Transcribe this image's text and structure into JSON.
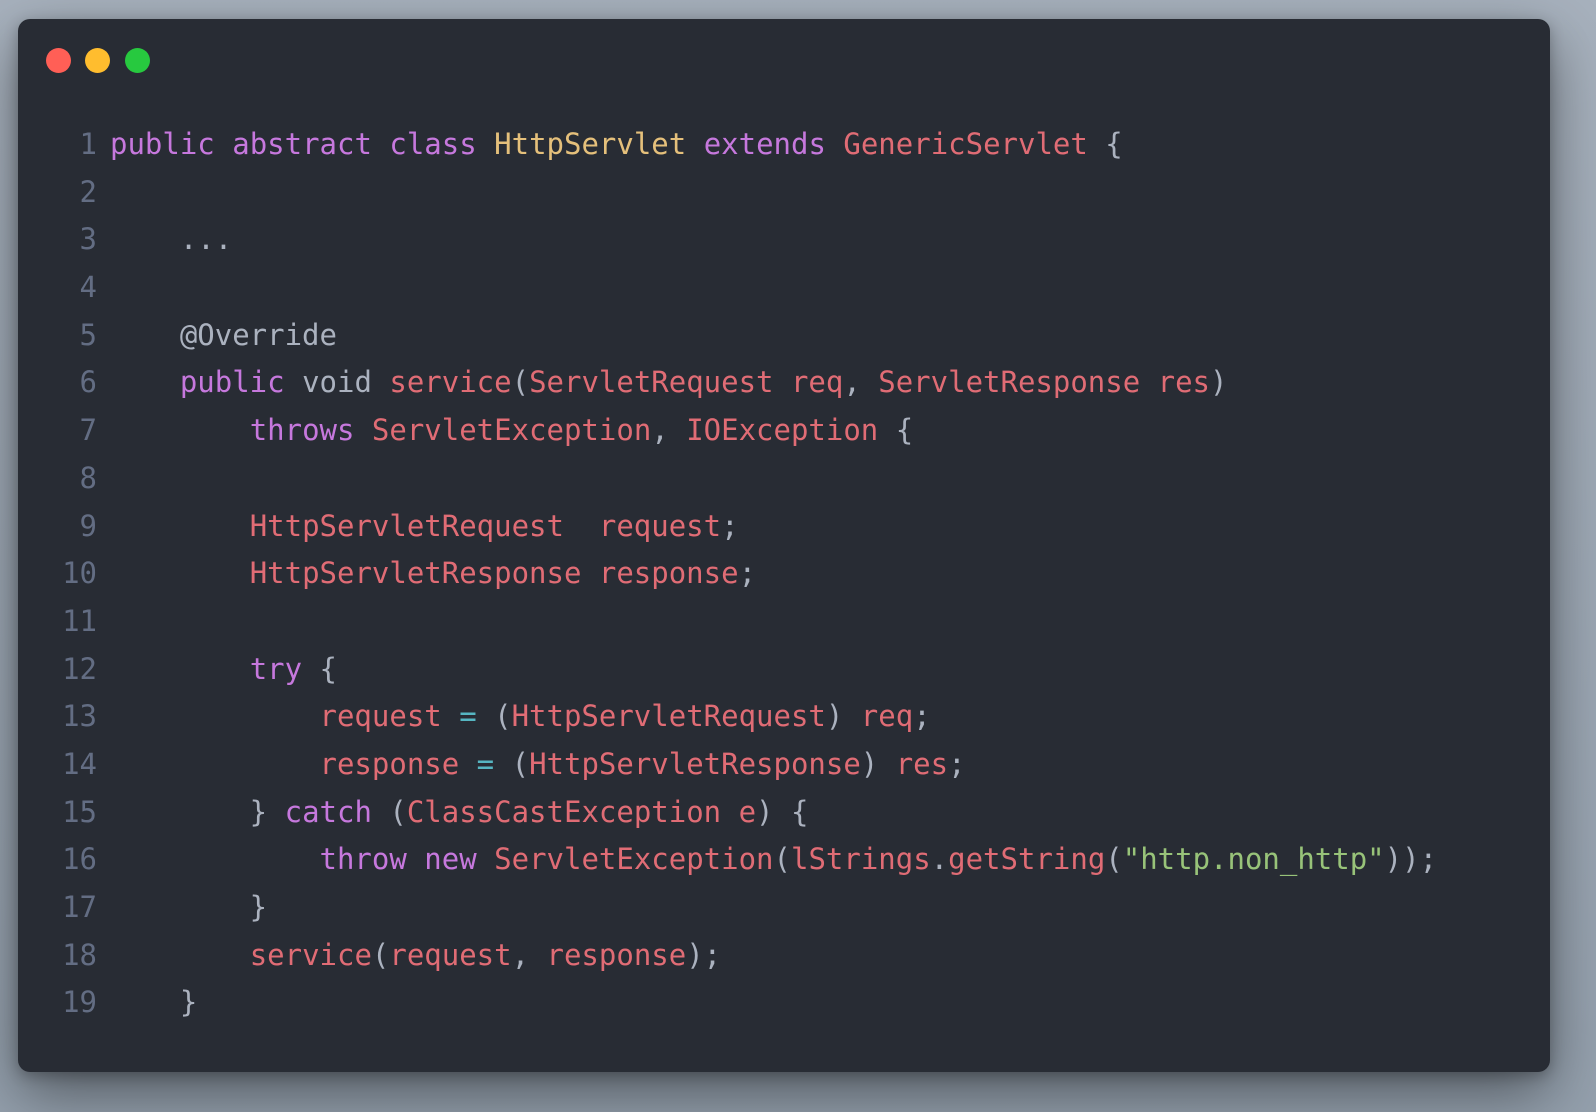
{
  "window": {
    "controls": {
      "close": {
        "icon": "close-dot-icon",
        "color": "#ff5f56"
      },
      "minimize": {
        "icon": "minimize-dot-icon",
        "color": "#ffbd2e"
      },
      "maximize": {
        "icon": "maximize-dot-icon",
        "color": "#27c93f"
      }
    }
  },
  "theme": {
    "background": "#282c34",
    "line_number": "#636d83",
    "plain": "#abb2bf",
    "keyword": "#c678dd",
    "class_name": "#e5c07b",
    "identifier": "#e06c75",
    "operator": "#56b6c2",
    "string": "#98c379"
  },
  "code": {
    "lines": [
      {
        "number": "1",
        "tokens": [
          {
            "t": "public",
            "c": "keyword"
          },
          {
            "t": " ",
            "c": "plain"
          },
          {
            "t": "abstract",
            "c": "keyword"
          },
          {
            "t": " ",
            "c": "plain"
          },
          {
            "t": "class",
            "c": "keyword"
          },
          {
            "t": " ",
            "c": "plain"
          },
          {
            "t": "HttpServlet",
            "c": "class_name"
          },
          {
            "t": " ",
            "c": "plain"
          },
          {
            "t": "extends",
            "c": "keyword"
          },
          {
            "t": " ",
            "c": "plain"
          },
          {
            "t": "GenericServlet",
            "c": "identifier"
          },
          {
            "t": " {",
            "c": "plain"
          }
        ]
      },
      {
        "number": "2",
        "tokens": []
      },
      {
        "number": "3",
        "tokens": [
          {
            "t": "    ...",
            "c": "plain"
          }
        ]
      },
      {
        "number": "4",
        "tokens": []
      },
      {
        "number": "5",
        "tokens": [
          {
            "t": "    @Override",
            "c": "plain"
          }
        ]
      },
      {
        "number": "6",
        "tokens": [
          {
            "t": "    ",
            "c": "plain"
          },
          {
            "t": "public",
            "c": "keyword"
          },
          {
            "t": " void ",
            "c": "plain"
          },
          {
            "t": "service",
            "c": "identifier"
          },
          {
            "t": "(",
            "c": "plain"
          },
          {
            "t": "ServletRequest req",
            "c": "identifier"
          },
          {
            "t": ", ",
            "c": "plain"
          },
          {
            "t": "ServletResponse res",
            "c": "identifier"
          },
          {
            "t": ")",
            "c": "plain"
          }
        ]
      },
      {
        "number": "7",
        "tokens": [
          {
            "t": "        ",
            "c": "plain"
          },
          {
            "t": "throws",
            "c": "keyword"
          },
          {
            "t": " ",
            "c": "plain"
          },
          {
            "t": "ServletException",
            "c": "identifier"
          },
          {
            "t": ", ",
            "c": "plain"
          },
          {
            "t": "IOException",
            "c": "identifier"
          },
          {
            "t": " {",
            "c": "plain"
          }
        ]
      },
      {
        "number": "8",
        "tokens": []
      },
      {
        "number": "9",
        "tokens": [
          {
            "t": "        ",
            "c": "plain"
          },
          {
            "t": "HttpServletRequest  request",
            "c": "identifier"
          },
          {
            "t": ";",
            "c": "plain"
          }
        ]
      },
      {
        "number": "10",
        "tokens": [
          {
            "t": "        ",
            "c": "plain"
          },
          {
            "t": "HttpServletResponse response",
            "c": "identifier"
          },
          {
            "t": ";",
            "c": "plain"
          }
        ]
      },
      {
        "number": "11",
        "tokens": []
      },
      {
        "number": "12",
        "tokens": [
          {
            "t": "        ",
            "c": "plain"
          },
          {
            "t": "try",
            "c": "keyword"
          },
          {
            "t": " {",
            "c": "plain"
          }
        ]
      },
      {
        "number": "13",
        "tokens": [
          {
            "t": "            ",
            "c": "plain"
          },
          {
            "t": "request",
            "c": "identifier"
          },
          {
            "t": " ",
            "c": "plain"
          },
          {
            "t": "=",
            "c": "operator"
          },
          {
            "t": " (",
            "c": "plain"
          },
          {
            "t": "HttpServletRequest",
            "c": "identifier"
          },
          {
            "t": ") ",
            "c": "plain"
          },
          {
            "t": "req",
            "c": "identifier"
          },
          {
            "t": ";",
            "c": "plain"
          }
        ]
      },
      {
        "number": "14",
        "tokens": [
          {
            "t": "            ",
            "c": "plain"
          },
          {
            "t": "response",
            "c": "identifier"
          },
          {
            "t": " ",
            "c": "plain"
          },
          {
            "t": "=",
            "c": "operator"
          },
          {
            "t": " (",
            "c": "plain"
          },
          {
            "t": "HttpServletResponse",
            "c": "identifier"
          },
          {
            "t": ") ",
            "c": "plain"
          },
          {
            "t": "res",
            "c": "identifier"
          },
          {
            "t": ";",
            "c": "plain"
          }
        ]
      },
      {
        "number": "15",
        "tokens": [
          {
            "t": "        } ",
            "c": "plain"
          },
          {
            "t": "catch",
            "c": "keyword"
          },
          {
            "t": " (",
            "c": "plain"
          },
          {
            "t": "ClassCastException e",
            "c": "identifier"
          },
          {
            "t": ") {",
            "c": "plain"
          }
        ]
      },
      {
        "number": "16",
        "tokens": [
          {
            "t": "            ",
            "c": "plain"
          },
          {
            "t": "throw",
            "c": "keyword"
          },
          {
            "t": " ",
            "c": "plain"
          },
          {
            "t": "new",
            "c": "keyword"
          },
          {
            "t": " ",
            "c": "plain"
          },
          {
            "t": "ServletException",
            "c": "identifier"
          },
          {
            "t": "(",
            "c": "plain"
          },
          {
            "t": "lStrings",
            "c": "identifier"
          },
          {
            "t": ".",
            "c": "plain"
          },
          {
            "t": "getString",
            "c": "identifier"
          },
          {
            "t": "(",
            "c": "plain"
          },
          {
            "t": "\"http.non_http\"",
            "c": "string"
          },
          {
            "t": "));",
            "c": "plain"
          }
        ]
      },
      {
        "number": "17",
        "tokens": [
          {
            "t": "        }",
            "c": "plain"
          }
        ]
      },
      {
        "number": "18",
        "tokens": [
          {
            "t": "        ",
            "c": "plain"
          },
          {
            "t": "service",
            "c": "identifier"
          },
          {
            "t": "(",
            "c": "plain"
          },
          {
            "t": "request",
            "c": "identifier"
          },
          {
            "t": ", ",
            "c": "plain"
          },
          {
            "t": "response",
            "c": "identifier"
          },
          {
            "t": ");",
            "c": "plain"
          }
        ]
      },
      {
        "number": "19",
        "tokens": [
          {
            "t": "    }",
            "c": "plain"
          }
        ]
      }
    ]
  }
}
